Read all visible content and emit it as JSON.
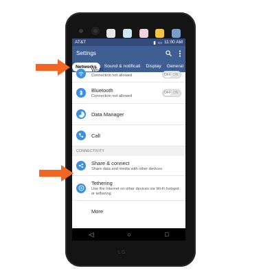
{
  "status_bar": {
    "carrier": "AT&T",
    "time": "11:00 AM"
  },
  "app_bar": {
    "title": "Settings",
    "search_icon": "search-icon",
    "more_icon": "more-vert-icon"
  },
  "tabs": [
    {
      "label": "Networks",
      "active": true
    },
    {
      "label": "Sound & notificati",
      "active": false
    },
    {
      "label": "Display",
      "active": false
    },
    {
      "label": "General",
      "active": false
    }
  ],
  "items": [
    {
      "title": "Wi-Fi",
      "subtitle": "Connection not allowed",
      "icon": "wifi-icon",
      "toggle_left": "OFF",
      "toggle_right": "ON"
    },
    {
      "title": "Bluetooth",
      "subtitle": "Connection not allowed",
      "icon": "bluetooth-icon",
      "toggle_left": "OFF",
      "toggle_right": "ON"
    },
    {
      "title": "Data Manager",
      "icon": "data-manager-icon"
    },
    {
      "title": "Call",
      "icon": "call-icon"
    }
  ],
  "section_connectivity": "CONNECTIVITY",
  "connectivity_items": [
    {
      "title": "Share & connect",
      "subtitle": "Share data and media with other devices",
      "icon": "share-icon"
    },
    {
      "title": "Tethering",
      "subtitle": "Use the Internet on other devices via Wi-Fi hotspot or tethering",
      "icon": "tethering-icon"
    },
    {
      "title": "More"
    }
  ],
  "brand": "LG",
  "colors": {
    "accent": "#3f5e92",
    "status": "#324b7a",
    "item_icon": "#3d8fe0",
    "arrow": "#f26522"
  }
}
